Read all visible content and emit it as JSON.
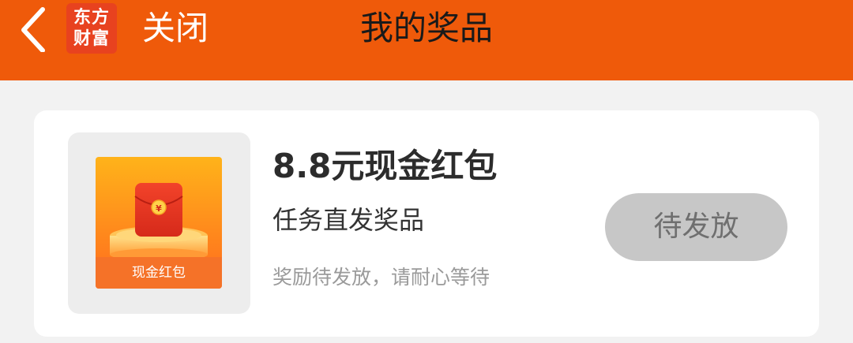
{
  "header": {
    "back_icon": "chevron-left-icon",
    "logo": {
      "line1": "东方",
      "line2": "财富"
    },
    "close_label": "关闭",
    "title": "我的奖品"
  },
  "prize": {
    "image_label": "现金红包",
    "title": "8.8元现金红包",
    "subtitle": "任务直发奖品",
    "note": "奖励待发放，请耐心等待",
    "status_label": "待发放",
    "coin_symbol": "¥"
  },
  "colors": {
    "header_bg": "#ef5a0a",
    "page_bg": "#f2f2f2",
    "status_button_bg": "#c7c7c7",
    "status_button_text": "#6f6f6f"
  }
}
